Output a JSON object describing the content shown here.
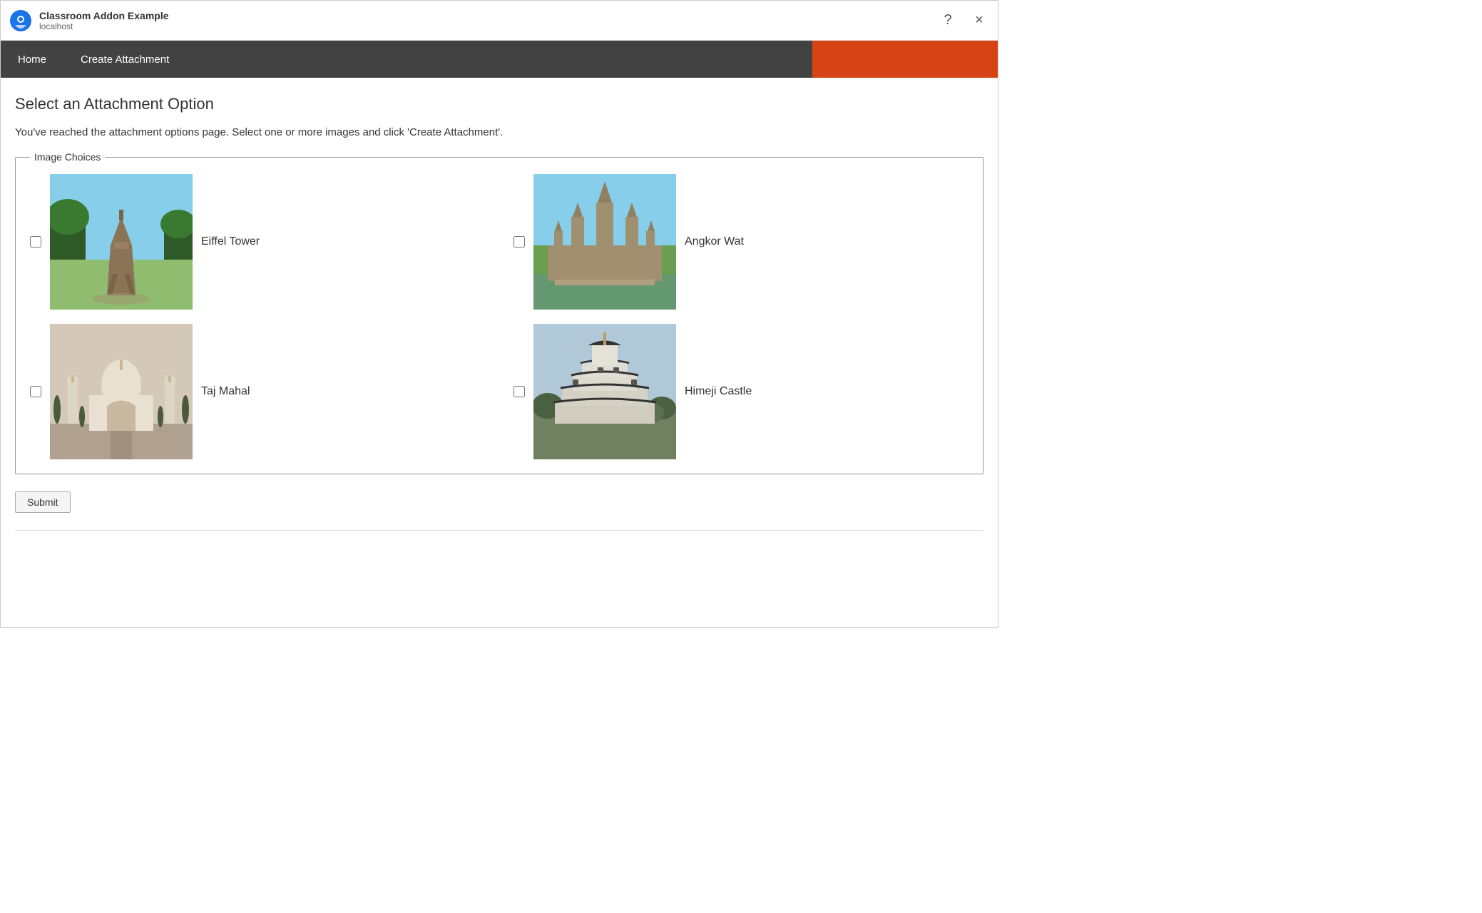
{
  "window": {
    "app_title": "Classroom Addon Example",
    "app_url": "localhost"
  },
  "titlebar": {
    "help_label": "?",
    "close_label": "×"
  },
  "navbar": {
    "home_label": "Home",
    "create_attachment_label": "Create Attachment"
  },
  "page": {
    "heading": "Select an Attachment Option",
    "description": "You've reached the attachment options page. Select one or more images and click 'Create Attachment'.",
    "fieldset_legend": "Image Choices",
    "submit_label": "Submit"
  },
  "images": [
    {
      "id": "eiffel",
      "label": "Eiffel Tower",
      "style_class": "img-eiffel"
    },
    {
      "id": "angkor",
      "label": "Angkor Wat",
      "style_class": "img-angkor"
    },
    {
      "id": "taj",
      "label": "Taj Mahal",
      "style_class": "img-taj"
    },
    {
      "id": "himeji",
      "label": "Himeji Castle",
      "style_class": "img-himeji"
    }
  ],
  "colors": {
    "nav_bg": "#424242",
    "accent": "#D84315"
  }
}
